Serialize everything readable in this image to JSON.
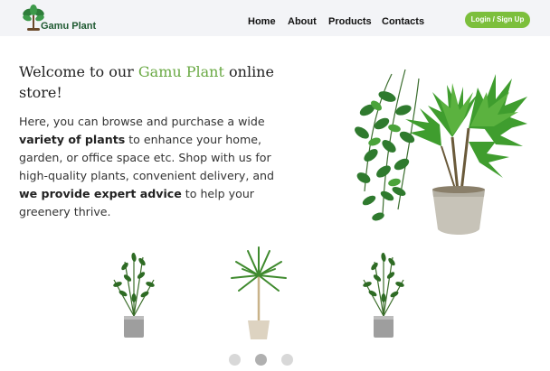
{
  "brand": {
    "name": "Gamu Plant",
    "logo_icon": "palm-tree-logo-icon"
  },
  "nav": {
    "items": [
      {
        "label": "Home"
      },
      {
        "label": "About"
      },
      {
        "label": "Products"
      },
      {
        "label": "Contacts"
      }
    ],
    "login_label": "Login / Sign Up"
  },
  "hero": {
    "welcome_prefix": "Welcome to our ",
    "welcome_brand": "Gamu Plant",
    "welcome_suffix": " online store!",
    "intro": {
      "t1": "Here, you can browse and purchase a wide ",
      "b1": "variety of plants",
      "t2": " to enhance your home, garden, or office space etc.  Shop with us for high-quality plants, convenient delivery, and ",
      "b2": "we provide expert advice",
      "t3": " to help your greenery thrive."
    },
    "image_icon": "potted-palm-image"
  },
  "carousel": {
    "items": [
      {
        "icon": "zz-plant-image"
      },
      {
        "icon": "dracaena-tree-image"
      },
      {
        "icon": "zz-plant-image"
      }
    ],
    "dot_count": 3,
    "active_index": 1
  },
  "colors": {
    "accent": "#6aa944",
    "button": "#7cbf3c",
    "nav_background": "#f3f4f7",
    "brand_text": "#1f5a32"
  }
}
